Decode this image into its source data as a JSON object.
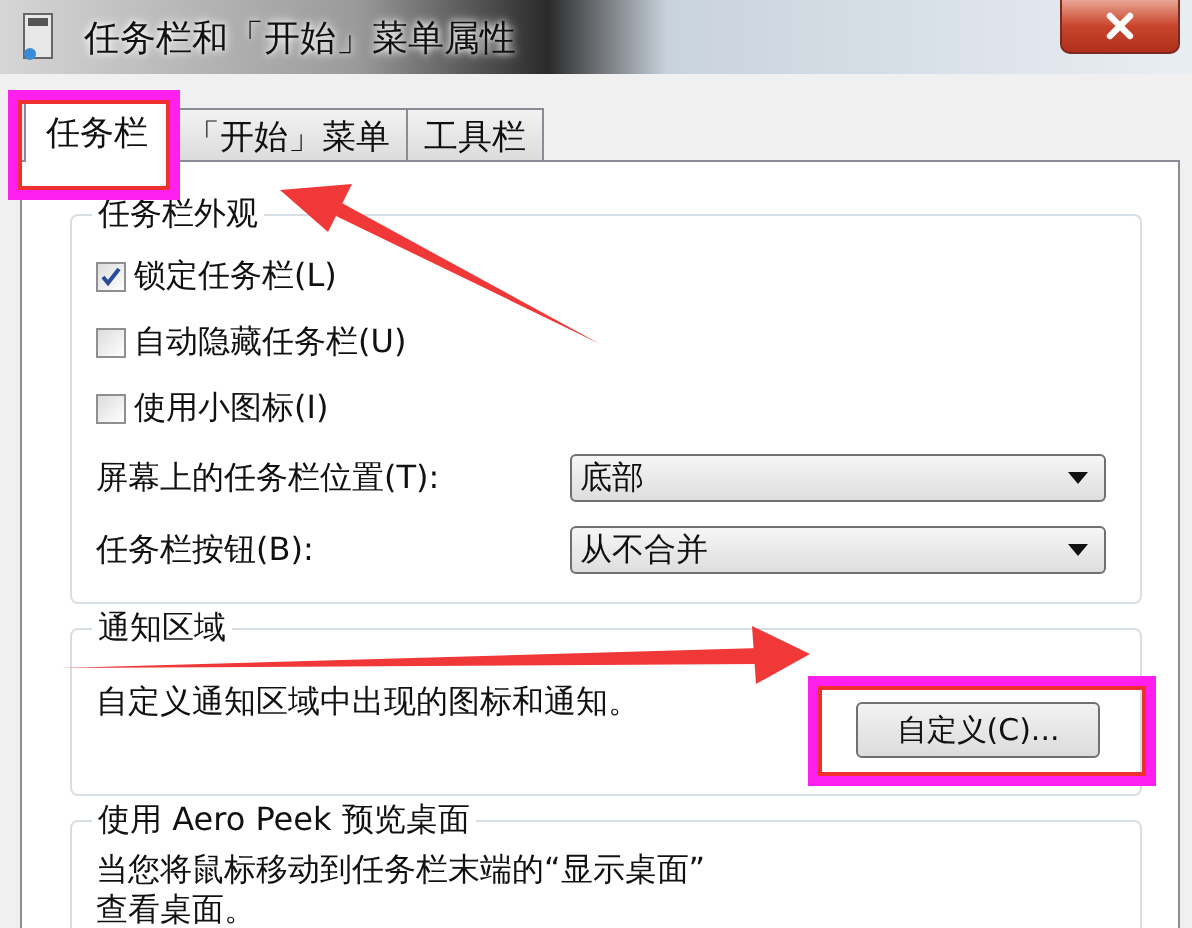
{
  "window": {
    "title": "任务栏和「开始」菜单属性"
  },
  "tabs": [
    {
      "label": "任务栏",
      "selected": true,
      "highlighted": true
    },
    {
      "label": "「开始」菜单",
      "selected": false,
      "highlighted": false
    },
    {
      "label": "工具栏",
      "selected": false,
      "highlighted": false
    }
  ],
  "groups": [
    {
      "title": "任务栏外观",
      "rows": [
        {
          "kind": "checkbox",
          "label": "锁定任务栏(L)",
          "checked": true
        },
        {
          "kind": "checkbox",
          "label": "自动隐藏任务栏(U)",
          "checked": false
        },
        {
          "kind": "checkbox",
          "label": "使用小图标(I)",
          "checked": false
        },
        {
          "kind": "combo",
          "label": "屏幕上的任务栏位置(T):",
          "value": "底部"
        },
        {
          "kind": "combo",
          "label": "任务栏按钮(B):",
          "value": "从不合并"
        }
      ]
    },
    {
      "title": "通知区域",
      "rows": [
        {
          "kind": "text_button",
          "label": "自定义通知区域中出现的图标和通知。",
          "button": "自定义(C)...",
          "highlighted": true
        }
      ]
    },
    {
      "title": "使用 Aero Peek 预览桌面",
      "rows": [
        {
          "kind": "paragraph",
          "lines": [
            "当您将鼠标移动到任务栏末端的“显示桌面”",
            "查看桌面。"
          ]
        }
      ]
    }
  ]
}
